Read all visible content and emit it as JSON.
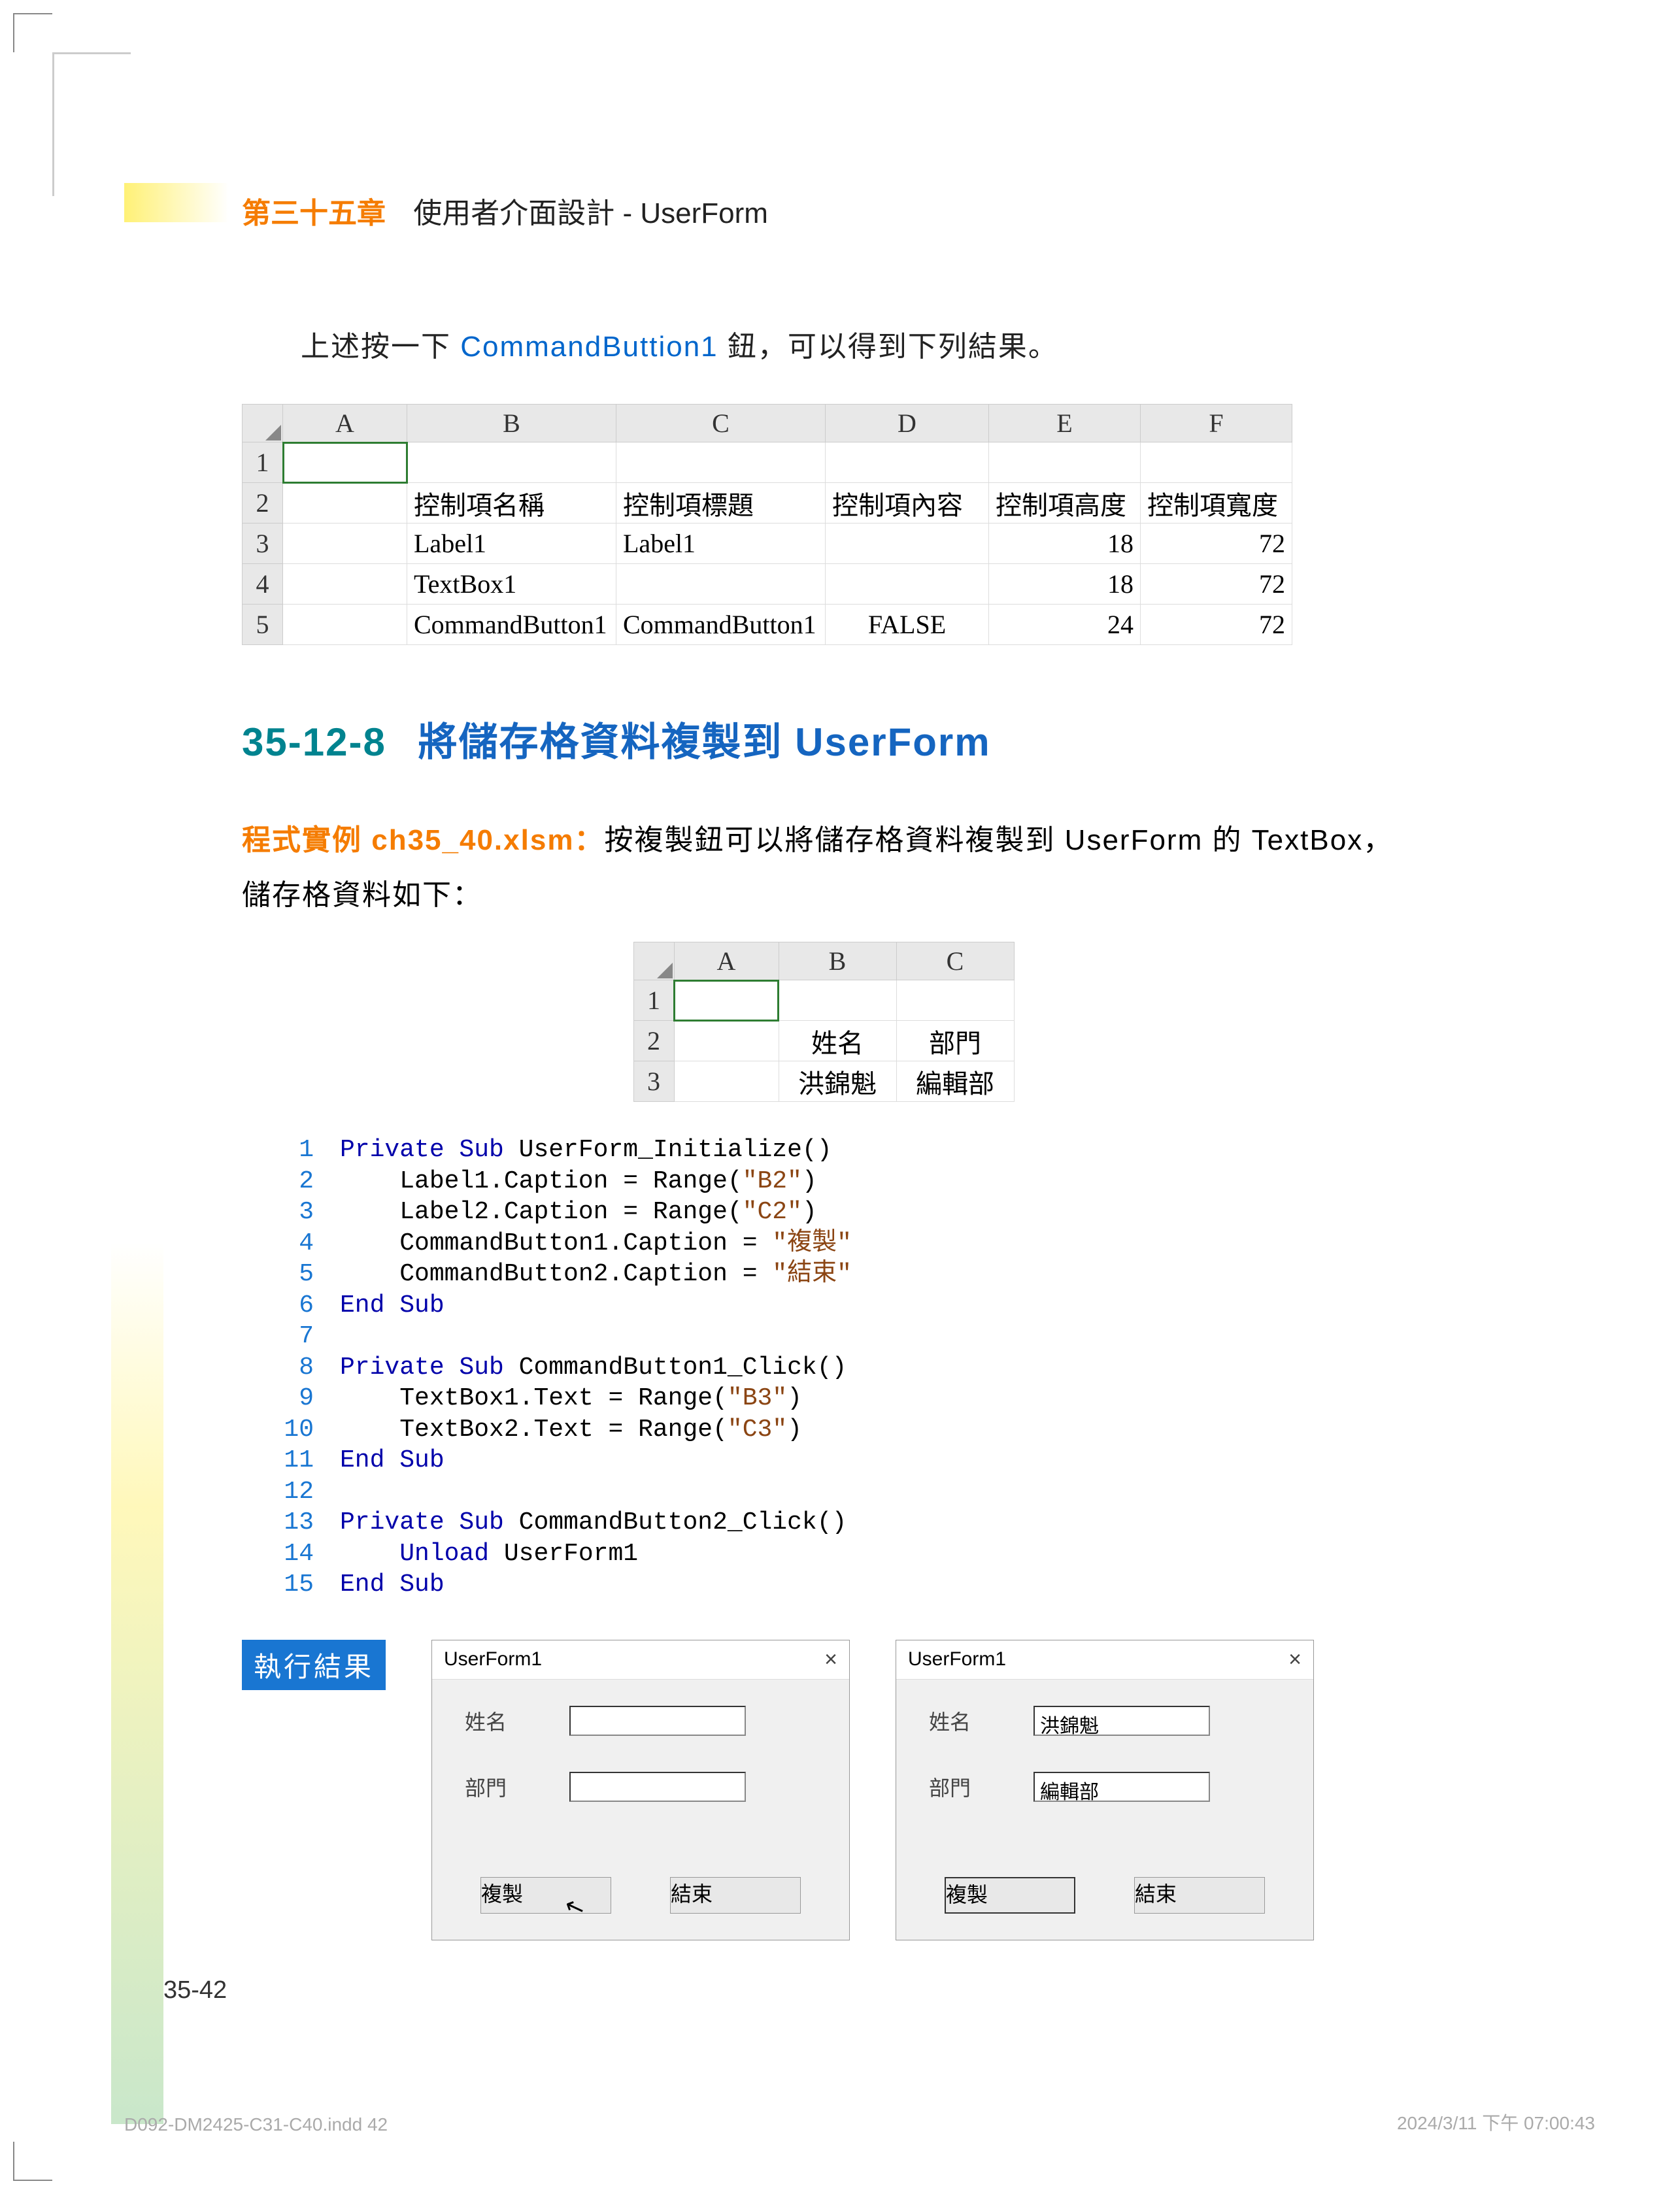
{
  "header": {
    "chapter": "第三十五章",
    "title": "使用者介面設計 - UserForm"
  },
  "intro": {
    "prefix": "上述按一下 ",
    "blue": "CommandButtion1",
    "suffix": " 鈕，可以得到下列結果。"
  },
  "table1": {
    "cols": [
      "A",
      "B",
      "C",
      "D",
      "E",
      "F"
    ],
    "rows": [
      {
        "n": "1",
        "cells": [
          "",
          "",
          "",
          "",
          "",
          ""
        ]
      },
      {
        "n": "2",
        "cells": [
          "",
          "控制項名稱",
          "控制項標題",
          "控制項內容",
          "控制項高度",
          "控制項寬度"
        ]
      },
      {
        "n": "3",
        "cells": [
          "",
          "Label1",
          "Label1",
          "",
          "18",
          "72"
        ]
      },
      {
        "n": "4",
        "cells": [
          "",
          "TextBox1",
          "",
          "",
          "18",
          "72"
        ]
      },
      {
        "n": "5",
        "cells": [
          "",
          "CommandButton1",
          "CommandButton1",
          "FALSE",
          "24",
          "72"
        ]
      }
    ]
  },
  "section": {
    "num": "35-12-8",
    "title": "將儲存格資料複製到 UserForm"
  },
  "body": {
    "orange": "程式實例 ch35_40.xlsm：",
    "text": "按複製鈕可以將儲存格資料複製到 UserForm 的 TextBox，儲存格資料如下："
  },
  "table2": {
    "cols": [
      "A",
      "B",
      "C"
    ],
    "rows": [
      {
        "n": "1",
        "cells": [
          "",
          "",
          ""
        ]
      },
      {
        "n": "2",
        "cells": [
          "",
          "姓名",
          "部門"
        ]
      },
      {
        "n": "3",
        "cells": [
          "",
          "洪錦魁",
          "編輯部"
        ]
      }
    ]
  },
  "code": [
    {
      "n": "1",
      "t": "Private Sub UserForm_Initialize()",
      "kw": [
        [
          0,
          11
        ]
      ]
    },
    {
      "n": "2",
      "t": "    Label1.Caption = Range(\"B2\")",
      "str": [
        [
          27,
          31
        ]
      ]
    },
    {
      "n": "3",
      "t": "    Label2.Caption = Range(\"C2\")",
      "str": [
        [
          27,
          31
        ]
      ]
    },
    {
      "n": "4",
      "t": "    CommandButton1.Caption = \"複製\"",
      "str": [
        [
          29,
          33
        ]
      ]
    },
    {
      "n": "5",
      "t": "    CommandButton2.Caption = \"結束\"",
      "str": [
        [
          29,
          33
        ]
      ]
    },
    {
      "n": "6",
      "t": "End Sub",
      "kw": [
        [
          0,
          7
        ]
      ]
    },
    {
      "n": "7",
      "t": ""
    },
    {
      "n": "8",
      "t": "Private Sub CommandButton1_Click()",
      "kw": [
        [
          0,
          11
        ]
      ]
    },
    {
      "n": "9",
      "t": "    TextBox1.Text = Range(\"B3\")",
      "str": [
        [
          26,
          30
        ]
      ]
    },
    {
      "n": "10",
      "t": "    TextBox2.Text = Range(\"C3\")",
      "str": [
        [
          26,
          30
        ]
      ]
    },
    {
      "n": "11",
      "t": "End Sub",
      "kw": [
        [
          0,
          7
        ]
      ]
    },
    {
      "n": "12",
      "t": ""
    },
    {
      "n": "13",
      "t": "Private Sub CommandButton2_Click()",
      "kw": [
        [
          0,
          11
        ]
      ]
    },
    {
      "n": "14",
      "t": "    Unload UserForm1",
      "kw": [
        [
          4,
          10
        ]
      ]
    },
    {
      "n": "15",
      "t": "End Sub",
      "kw": [
        [
          0,
          7
        ]
      ]
    }
  ],
  "result_badge": "執行結果",
  "form1": {
    "title": "UserForm1",
    "l1": "姓名",
    "v1": "",
    "l2": "部門",
    "v2": "",
    "b1": "複製",
    "b2": "結束",
    "cursor_on_b1": true
  },
  "form2": {
    "title": "UserForm1",
    "l1": "姓名",
    "v1": "洪錦魁",
    "l2": "部門",
    "v2": "編輯部",
    "b1": "複製",
    "b2": "結束"
  },
  "page_num": "35-42",
  "footer_l": "D092-DM2425-C31-C40.indd   42",
  "footer_r": "2024/3/11   下午 07:00:43"
}
